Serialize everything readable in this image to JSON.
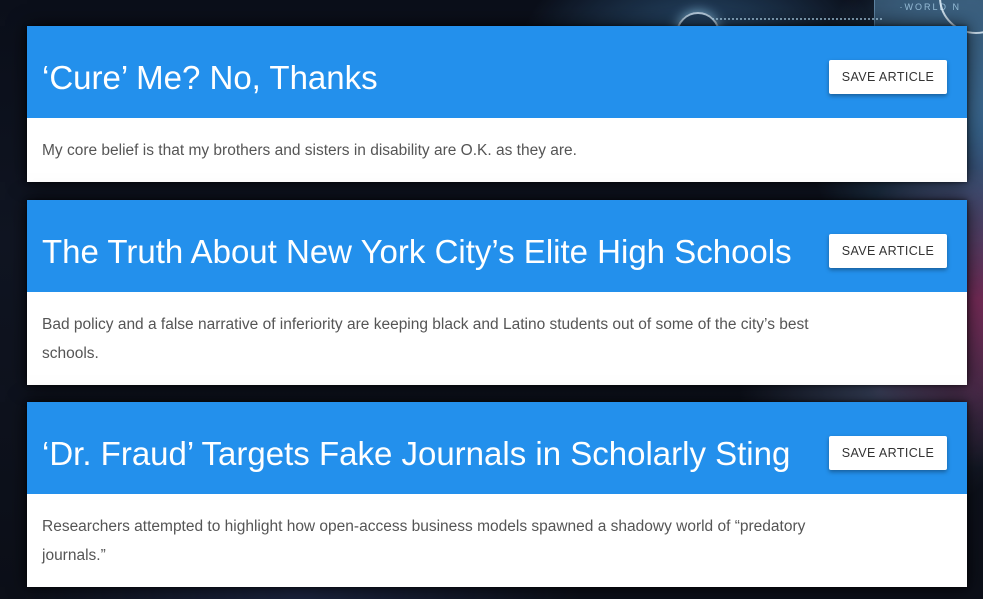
{
  "background": {
    "panel_text": "·WORLD N"
  },
  "articles": [
    {
      "title": "‘Cure’ Me? No, Thanks",
      "summary": "My core belief is that my brothers and sisters in disability are O.K. as they are.",
      "save_label": "SAVE ARTICLE"
    },
    {
      "title": "The Truth About New York City’s Elite High Schools",
      "summary": "Bad policy and a false narrative of inferiority are keeping black and Latino students out of some of the city’s best schools.",
      "save_label": "SAVE ARTICLE"
    },
    {
      "title": "‘Dr. Fraud’ Targets Fake Journals in Scholarly Sting",
      "summary": "Researchers attempted to highlight how open-access business models spawned a shadowy world of “predatory journals.”",
      "save_label": "SAVE ARTICLE"
    }
  ],
  "colors": {
    "header": "#2390ec",
    "body": "#ffffff",
    "title_text": "#ffffff",
    "summary_text": "#555555"
  }
}
